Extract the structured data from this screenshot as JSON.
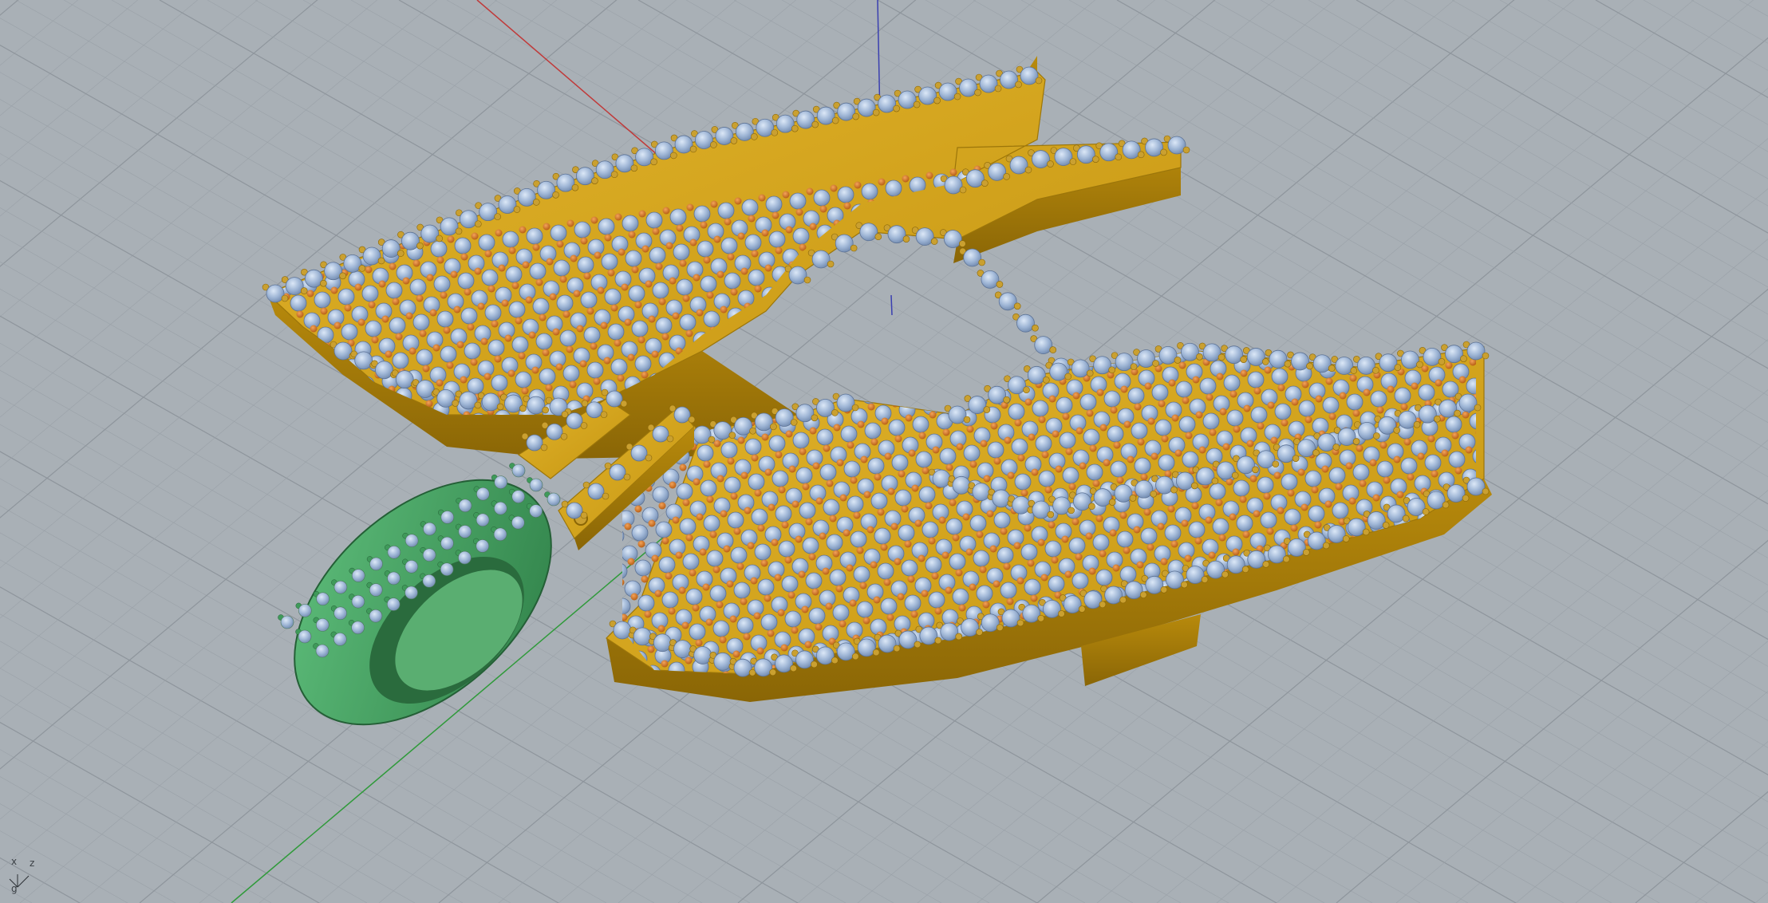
{
  "viewport": {
    "kind": "perspective-3d-view",
    "background_color": "#a9b0b6",
    "grid_color": "#9aa1a8",
    "grid_major_color": "#8e959c"
  },
  "axes": {
    "x_axis_color": "#c03a3a",
    "y_axis_color": "#2f9a3a",
    "z_axis_color": "#3a3fb0"
  },
  "gizmo": {
    "x_label": "x",
    "y_label": "g",
    "z_label": "z"
  },
  "model": {
    "pendant_metal_color": "#d4a017",
    "bail_metal_color": "#3f9a5a",
    "gem_color": "#9fb6d6",
    "small_gem_color": "#d8701c",
    "prong_color": "#caa030"
  }
}
